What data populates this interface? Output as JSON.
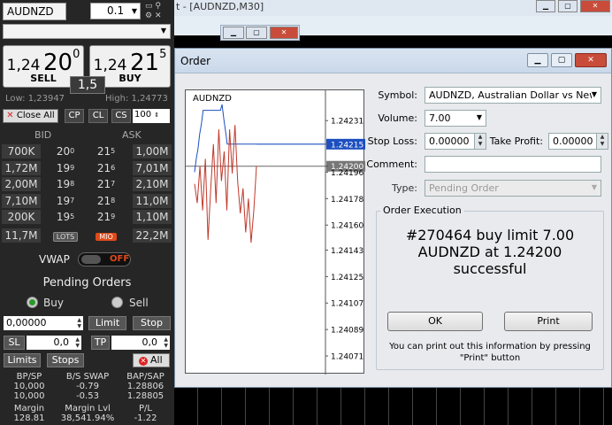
{
  "left_panel": {
    "symbol": "AUDNZD",
    "lot_size": "0.1",
    "sell": {
      "price_main": "1,24",
      "price_big": "20",
      "price_sup": "0",
      "label": "SELL"
    },
    "buy": {
      "price_main": "1,24",
      "price_big": "21",
      "price_sup": "5",
      "label": "BUY"
    },
    "spread": "1,5",
    "low": "Low: 1,23947",
    "high": "High: 1,24773",
    "close_all": "Close All",
    "cp": "CP",
    "cl": "CL",
    "cs": "CS",
    "cs_value": "100",
    "bid_header": "BID",
    "ask_header": "ASK",
    "dom_rows": [
      {
        "bid_vol": "700K",
        "bid": "20",
        "bid_sup": "0",
        "ask": "21",
        "ask_sup": "5",
        "ask_vol": "1,00M"
      },
      {
        "bid_vol": "1,72M",
        "bid": "19",
        "bid_sup": "9",
        "ask": "21",
        "ask_sup": "6",
        "ask_vol": "7,01M"
      },
      {
        "bid_vol": "2,00M",
        "bid": "19",
        "bid_sup": "8",
        "ask": "21",
        "ask_sup": "7",
        "ask_vol": "2,10M"
      },
      {
        "bid_vol": "7,10M",
        "bid": "19",
        "bid_sup": "7",
        "ask": "21",
        "ask_sup": "8",
        "ask_vol": "11,0M"
      },
      {
        "bid_vol": "200K",
        "bid": "19",
        "bid_sup": "5",
        "ask": "21",
        "ask_sup": "9",
        "ask_vol": "1,10M"
      }
    ],
    "total_bid": "11,7M",
    "lots_btn": "LOTS",
    "mio_btn": "MIO",
    "total_ask": "22,2M",
    "vwap_label": "VWAP",
    "vwap_state": "OFF",
    "pending_title": "Pending Orders",
    "buy_radio": "Buy",
    "sell_radio": "Sell",
    "pending_price": "0,00000",
    "limit_btn": "Limit",
    "stop_btn": "Stop",
    "sl_label": "SL",
    "sl_value": "0,0",
    "tp_label": "TP",
    "tp_value": "0,0",
    "limits_btn": "Limits",
    "stops_btn": "Stops",
    "all_btn": "All",
    "stats": {
      "h1": "BP/SP",
      "h2": "B/S SWAP",
      "h3": "BAP/SAP",
      "r1": [
        "10,000",
        "-0.79",
        "1.28806"
      ],
      "r2": [
        "10,000",
        "-0.53",
        "1.28805"
      ],
      "h4": "Margin",
      "h5": "Margin Lvl",
      "h6": "P/L",
      "r3": [
        "128.81",
        "38,541.94%",
        "-1.22"
      ]
    }
  },
  "background_window": {
    "title_fragment": "t - [AUDNZD,M30]"
  },
  "order_dialog": {
    "title": "Order",
    "chart_symbol": "AUDNZD",
    "symbol_label": "Symbol:",
    "symbol_value": "AUDNZD, Australian Dollar vs New Zea",
    "volume_label": "Volume:",
    "volume_value": "7.00",
    "sl_label": "Stop Loss:",
    "sl_value": "0.00000",
    "tp_label": "Take Profit:",
    "tp_value": "0.00000",
    "comment_label": "Comment:",
    "comment_value": "",
    "type_label": "Type:",
    "type_value": "Pending Order",
    "exec_title": "Order Execution",
    "message_line1": "#270464 buy limit 7.00",
    "message_line2": "AUDNZD at 1.24200",
    "message_line3": "successful",
    "ok_btn": "OK",
    "print_btn": "Print",
    "note_line1": "You can print out this information by pressing",
    "note_line2": "\"Print\" button"
  },
  "chart_data": {
    "type": "line",
    "title": "AUDNZD",
    "y_ticks": [
      "1.24231",
      "1.24215",
      "1.24200",
      "1.24196",
      "1.24178",
      "1.24160",
      "1.24143",
      "1.24125",
      "1.24107",
      "1.24089",
      "1.24071"
    ],
    "ylim": [
      1.24062,
      1.24248
    ],
    "ask_level": 1.24215,
    "order_level": 1.242,
    "series": [
      {
        "color": "#1c4fbf",
        "values": [
          1.24196,
          1.24205,
          1.24212,
          1.24222,
          1.24229,
          1.24238,
          1.24238,
          1.24238,
          1.24238,
          1.24238,
          1.24238,
          1.24238,
          1.24238,
          1.24238,
          1.24238,
          1.24238,
          1.24242,
          1.24232,
          1.24224,
          1.24215,
          1.24215,
          1.24215,
          1.24215,
          1.24215,
          1.24215,
          1.24215,
          1.24215,
          1.24215,
          1.24215,
          1.24215,
          1.24215,
          1.24215,
          1.24215,
          1.24215,
          1.24215,
          1.24215,
          1.24215
        ]
      },
      {
        "color": "#c0392b",
        "values": [
          1.24188,
          1.24175,
          1.242,
          1.2417,
          1.24205,
          1.2415,
          1.24185,
          1.24215,
          1.24175,
          1.24225,
          1.2419,
          1.2421,
          1.2417,
          1.24225,
          1.24195,
          1.24228,
          1.2419,
          1.24168,
          1.24185,
          1.24155,
          1.24178,
          1.24148,
          1.2417,
          1.242
        ]
      }
    ]
  }
}
